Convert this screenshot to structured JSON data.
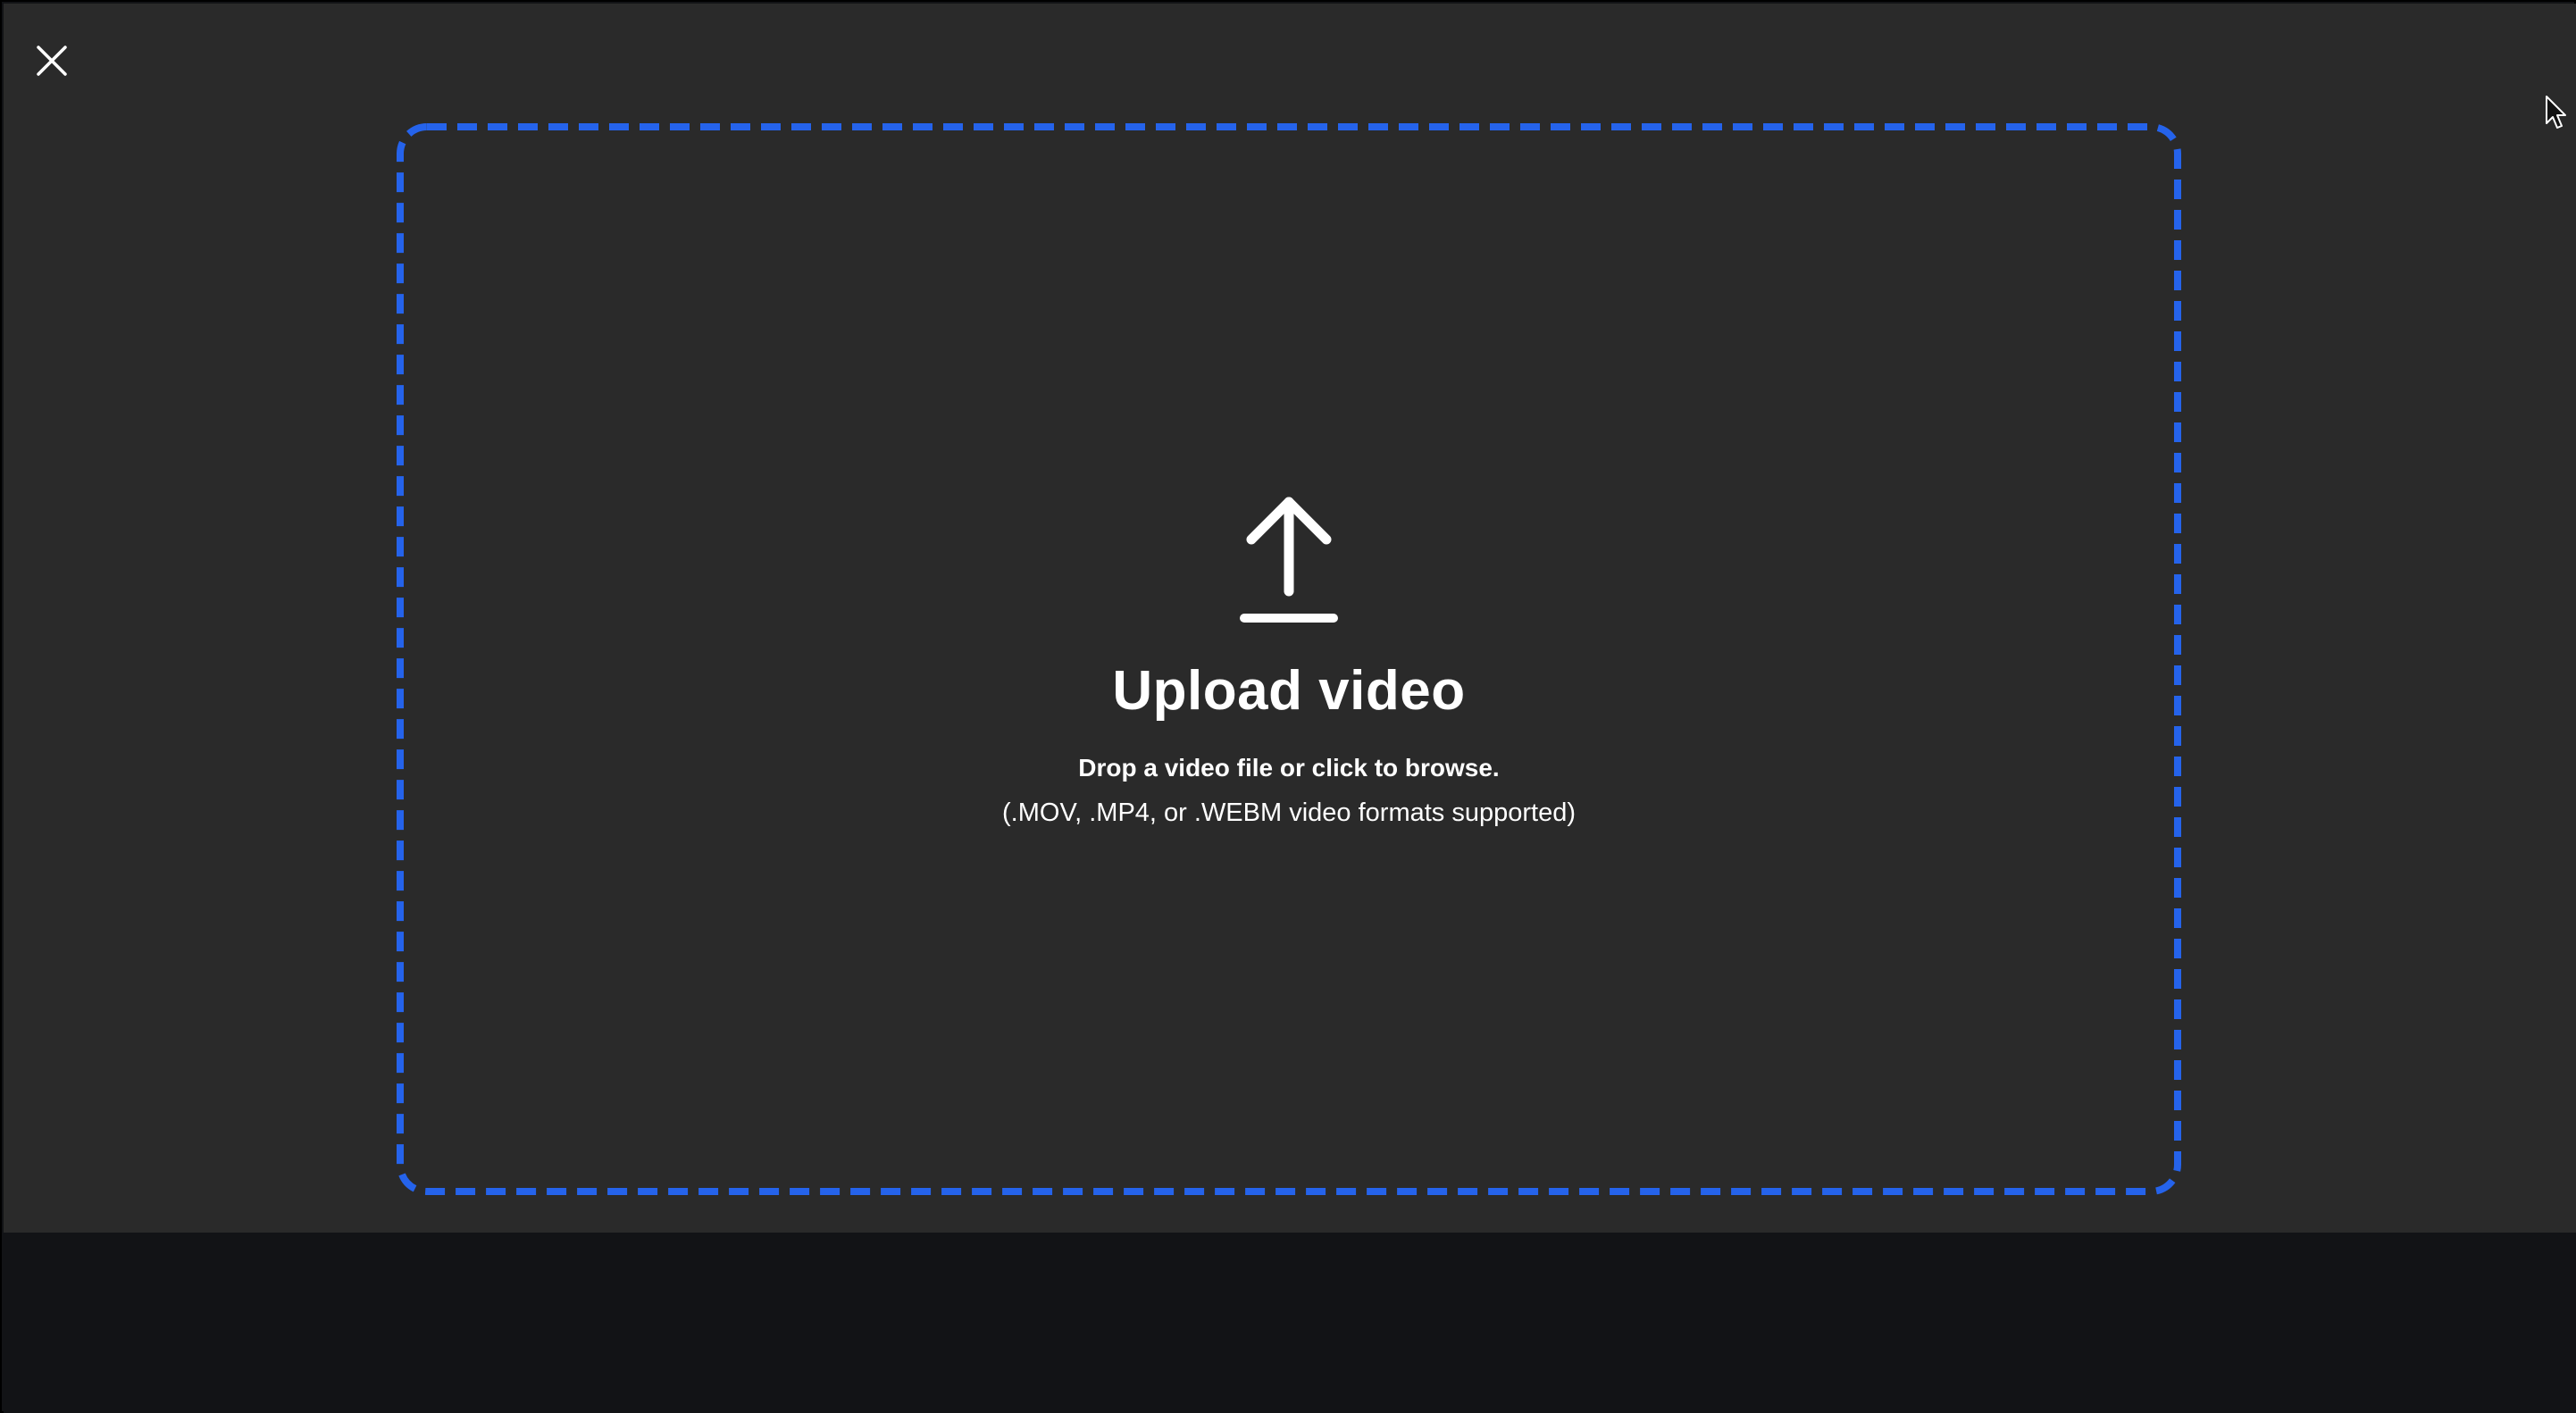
{
  "dropzone": {
    "title": "Upload video",
    "instruction": "Drop a video file or click to browse.",
    "formats": "(.MOV, .MP4, or .WEBM video formats supported)",
    "border_color": "#2563eb"
  },
  "icons": {
    "close": "close-icon",
    "upload": "upload-arrow-icon",
    "cursor": "mouse-pointer-icon"
  },
  "colors": {
    "modal_background": "#2a2a2a",
    "page_background": "#121316",
    "text": "#ffffff",
    "accent": "#2563eb"
  }
}
